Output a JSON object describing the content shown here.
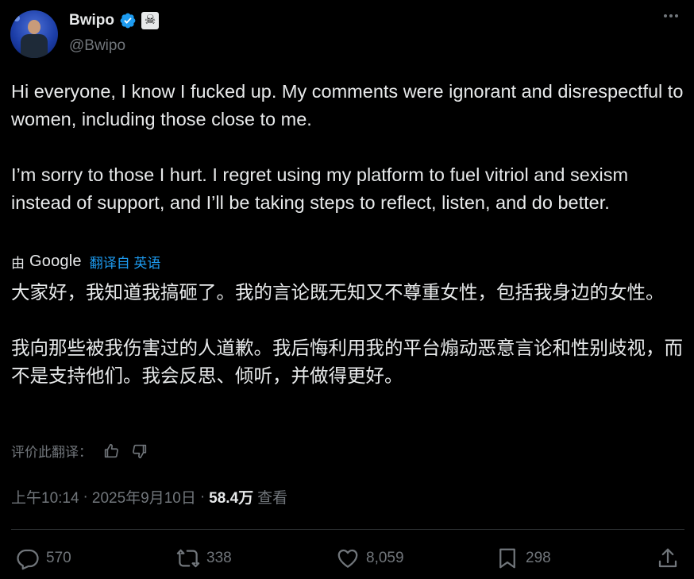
{
  "author": {
    "name": "Bwipo",
    "handle": "@Bwipo",
    "verified_color": "#1d9bf0",
    "badge_icon": "skull-crossbones-icon"
  },
  "tweet": {
    "paragraphs": [
      "Hi everyone, I know I fucked up. My comments were ignorant and disrespectful to women, including those close to me.",
      "I’m sorry to those I hurt. I regret using my platform to fuel vitriol and sexism instead of support, and I’ll be taking steps to reflect, listen, and do better."
    ]
  },
  "translation": {
    "by_label": "由",
    "provider": "Google",
    "from_label": "翻译自 英语",
    "paragraphs": [
      "大家好，我知道我搞砸了。我的言论既无知又不尊重女性，包括我身边的女性。",
      "我向那些被我伤害过的人道歉。我后悔利用我的平台煽动恶意言论和性别歧视，而不是支持他们。我会反思、倾听，并做得更好。"
    ],
    "rate_label": "评价此翻译："
  },
  "meta": {
    "time": "上午10:14",
    "sep1": "·",
    "date": "2025年9月10日",
    "sep2": "·",
    "views_count": "58.4万",
    "views_label": "查看"
  },
  "actions": {
    "replies": "570",
    "retweets": "338",
    "likes": "8,059",
    "bookmarks": "298"
  },
  "colors": {
    "background": "#000000",
    "text": "#e7e9ea",
    "muted": "#71767b",
    "accent": "#1d9bf0",
    "divider": "#2f3336"
  }
}
